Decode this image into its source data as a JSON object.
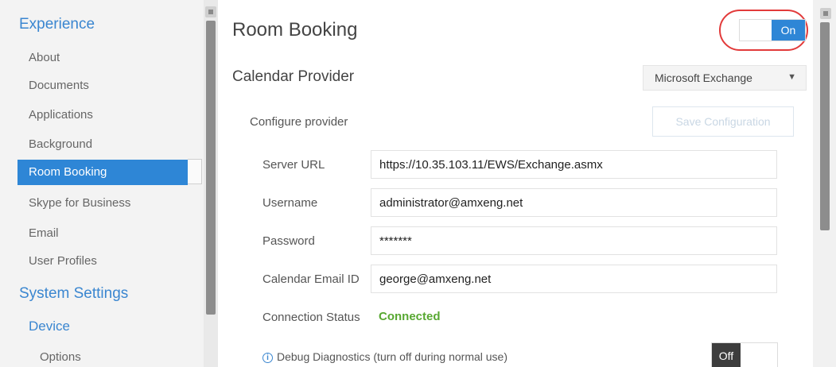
{
  "sidebar": {
    "sections": [
      {
        "title": "Experience"
      },
      {
        "title": "System Settings"
      }
    ],
    "experience_items": [
      "About",
      "Documents",
      "Applications",
      "Background",
      "Room Booking",
      "Skype for Business",
      "Email",
      "User Profiles"
    ],
    "system_settings_subheading": "Device",
    "device_items": [
      "Options"
    ],
    "active_item": "Room Booking"
  },
  "main": {
    "title": "Room Booking",
    "enabled_toggle": {
      "label": "On",
      "state": "on"
    },
    "calendar_provider": {
      "label": "Calendar Provider",
      "selected": "Microsoft Exchange",
      "caret_icon": "dropdown-arrow-icon"
    },
    "configure": {
      "label": "Configure provider",
      "save_button": "Save Configuration"
    },
    "fields": {
      "server_url": {
        "label": "Server URL",
        "value": "https://10.35.103.11/EWS/Exchange.asmx"
      },
      "username": {
        "label": "Username",
        "value": "administrator@amxeng.net"
      },
      "password": {
        "label": "Password",
        "value": "*******"
      },
      "calendar_email": {
        "label": "Calendar Email ID",
        "value": "george@amxeng.net"
      }
    },
    "connection_status": {
      "label": "Connection Status",
      "value": "Connected",
      "color": "#58a832"
    },
    "debug": {
      "info_icon": "info-icon",
      "label": "Debug Diagnostics (turn off during normal use)",
      "toggle_label": "Off",
      "state": "off"
    }
  },
  "colors": {
    "accent": "#2e86d6",
    "highlight_ring": "#e23a3a",
    "sidebar_bg": "#f3f3f3"
  }
}
